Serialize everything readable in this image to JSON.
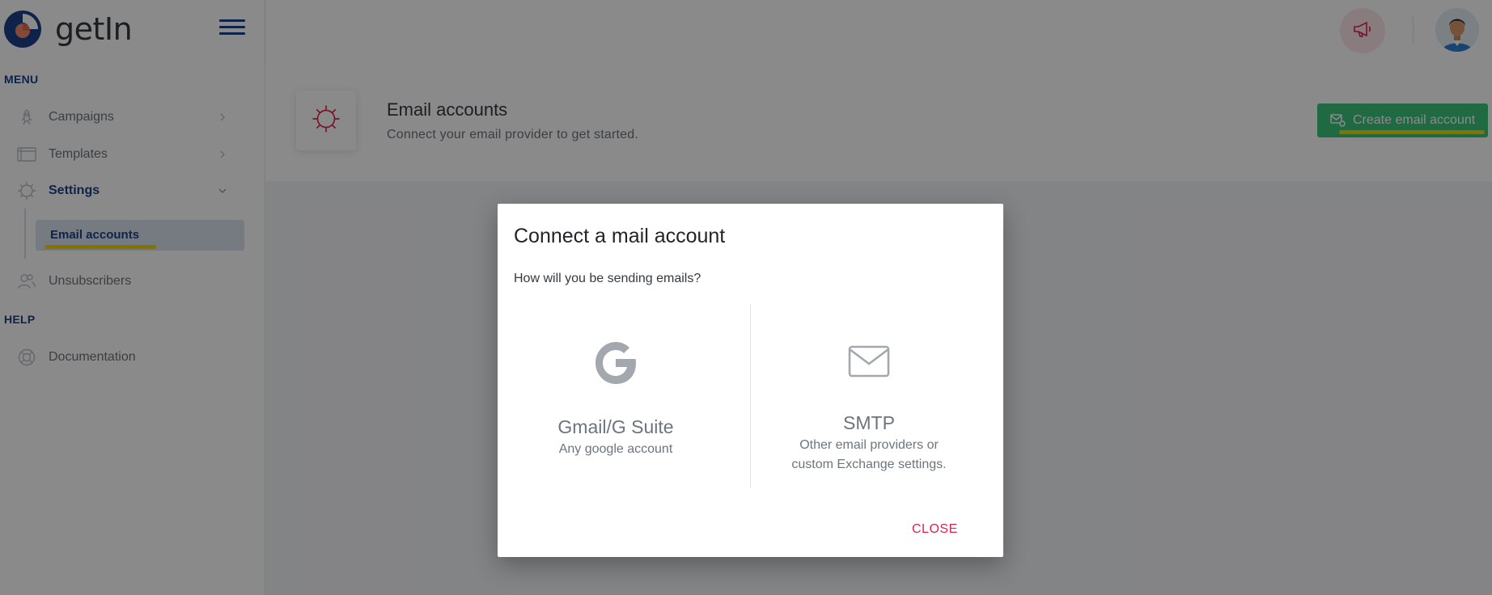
{
  "app": {
    "logo_text": "getIn"
  },
  "sidebar": {
    "menu_title": "MENU",
    "help_title": "HELP",
    "items": {
      "campaigns": "Campaigns",
      "templates": "Templates",
      "settings": "Settings",
      "email_accounts": "Email accounts",
      "unsubscribers": "Unsubscribers",
      "documentation": "Documentation"
    }
  },
  "header": {
    "title": "Email accounts",
    "subtitle": "Connect your email provider to get started.",
    "create_button": "Create email account"
  },
  "modal": {
    "title": "Connect a mail account",
    "question": "How will you be sending emails?",
    "gmail": {
      "title": "Gmail/G Suite",
      "desc": "Any google account"
    },
    "smtp": {
      "title": "SMTP",
      "desc": "Other email providers or custom Exchange settings."
    },
    "close": "CLOSE"
  },
  "colors": {
    "primary": "#1d4289",
    "success": "#3ac47d",
    "danger": "#d92550",
    "highlight": "#f5d400"
  }
}
